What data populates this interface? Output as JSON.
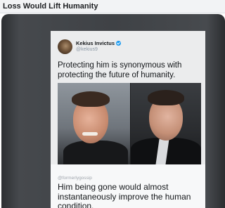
{
  "header": {
    "title": "Loss Would Lift Humanity"
  },
  "tweet": {
    "display_name": "Kekius Invictus",
    "handle": "@kekius9",
    "verified_icon": "verified-badge-icon",
    "text": "Protecting him is synonymous with protecting the future of humanity."
  },
  "reply": {
    "source": "@formerlygossip",
    "text": "Him being gone would almost instantaneously improve the human condition."
  },
  "colors": {
    "verified": "#1d9bf0",
    "background_dark": "#3f4246",
    "card": "#ebeced"
  }
}
